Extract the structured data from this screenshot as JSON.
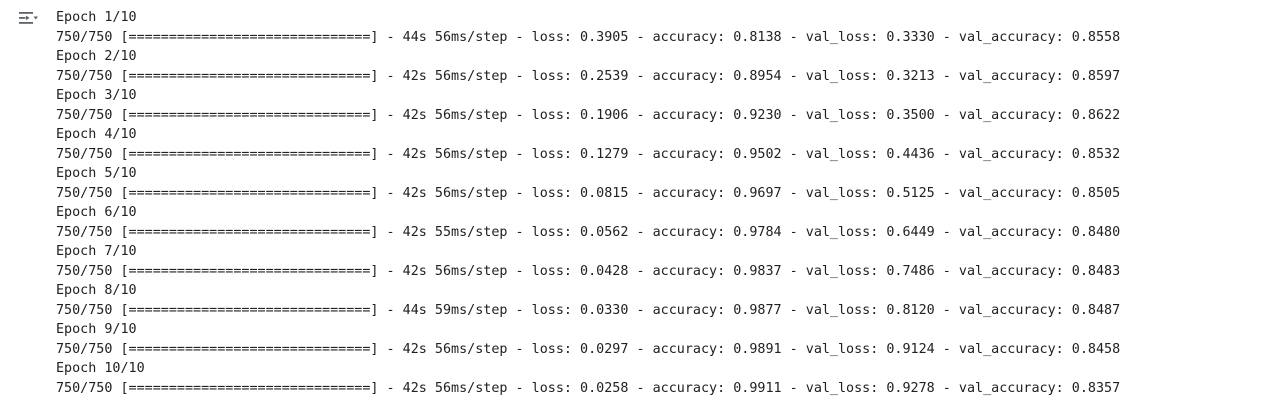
{
  "toolbar": {
    "toggle_icon": "output-collapse-icon"
  },
  "log": {
    "epochs": [
      {
        "header": "Epoch 1/10",
        "progress": "750/750 [==============================] - 44s 56ms/step - loss: 0.3905 - accuracy: 0.8138 - val_loss: 0.3330 - val_accuracy: 0.8558"
      },
      {
        "header": "Epoch 2/10",
        "progress": "750/750 [==============================] - 42s 56ms/step - loss: 0.2539 - accuracy: 0.8954 - val_loss: 0.3213 - val_accuracy: 0.8597"
      },
      {
        "header": "Epoch 3/10",
        "progress": "750/750 [==============================] - 42s 56ms/step - loss: 0.1906 - accuracy: 0.9230 - val_loss: 0.3500 - val_accuracy: 0.8622"
      },
      {
        "header": "Epoch 4/10",
        "progress": "750/750 [==============================] - 42s 56ms/step - loss: 0.1279 - accuracy: 0.9502 - val_loss: 0.4436 - val_accuracy: 0.8532"
      },
      {
        "header": "Epoch 5/10",
        "progress": "750/750 [==============================] - 42s 56ms/step - loss: 0.0815 - accuracy: 0.9697 - val_loss: 0.5125 - val_accuracy: 0.8505"
      },
      {
        "header": "Epoch 6/10",
        "progress": "750/750 [==============================] - 42s 55ms/step - loss: 0.0562 - accuracy: 0.9784 - val_loss: 0.6449 - val_accuracy: 0.8480"
      },
      {
        "header": "Epoch 7/10",
        "progress": "750/750 [==============================] - 42s 56ms/step - loss: 0.0428 - accuracy: 0.9837 - val_loss: 0.7486 - val_accuracy: 0.8483"
      },
      {
        "header": "Epoch 8/10",
        "progress": "750/750 [==============================] - 44s 59ms/step - loss: 0.0330 - accuracy: 0.9877 - val_loss: 0.8120 - val_accuracy: 0.8487"
      },
      {
        "header": "Epoch 9/10",
        "progress": "750/750 [==============================] - 42s 56ms/step - loss: 0.0297 - accuracy: 0.9891 - val_loss: 0.9124 - val_accuracy: 0.8458"
      },
      {
        "header": "Epoch 10/10",
        "progress": "750/750 [==============================] - 42s 56ms/step - loss: 0.0258 - accuracy: 0.9911 - val_loss: 0.9278 - val_accuracy: 0.8357"
      }
    ]
  }
}
